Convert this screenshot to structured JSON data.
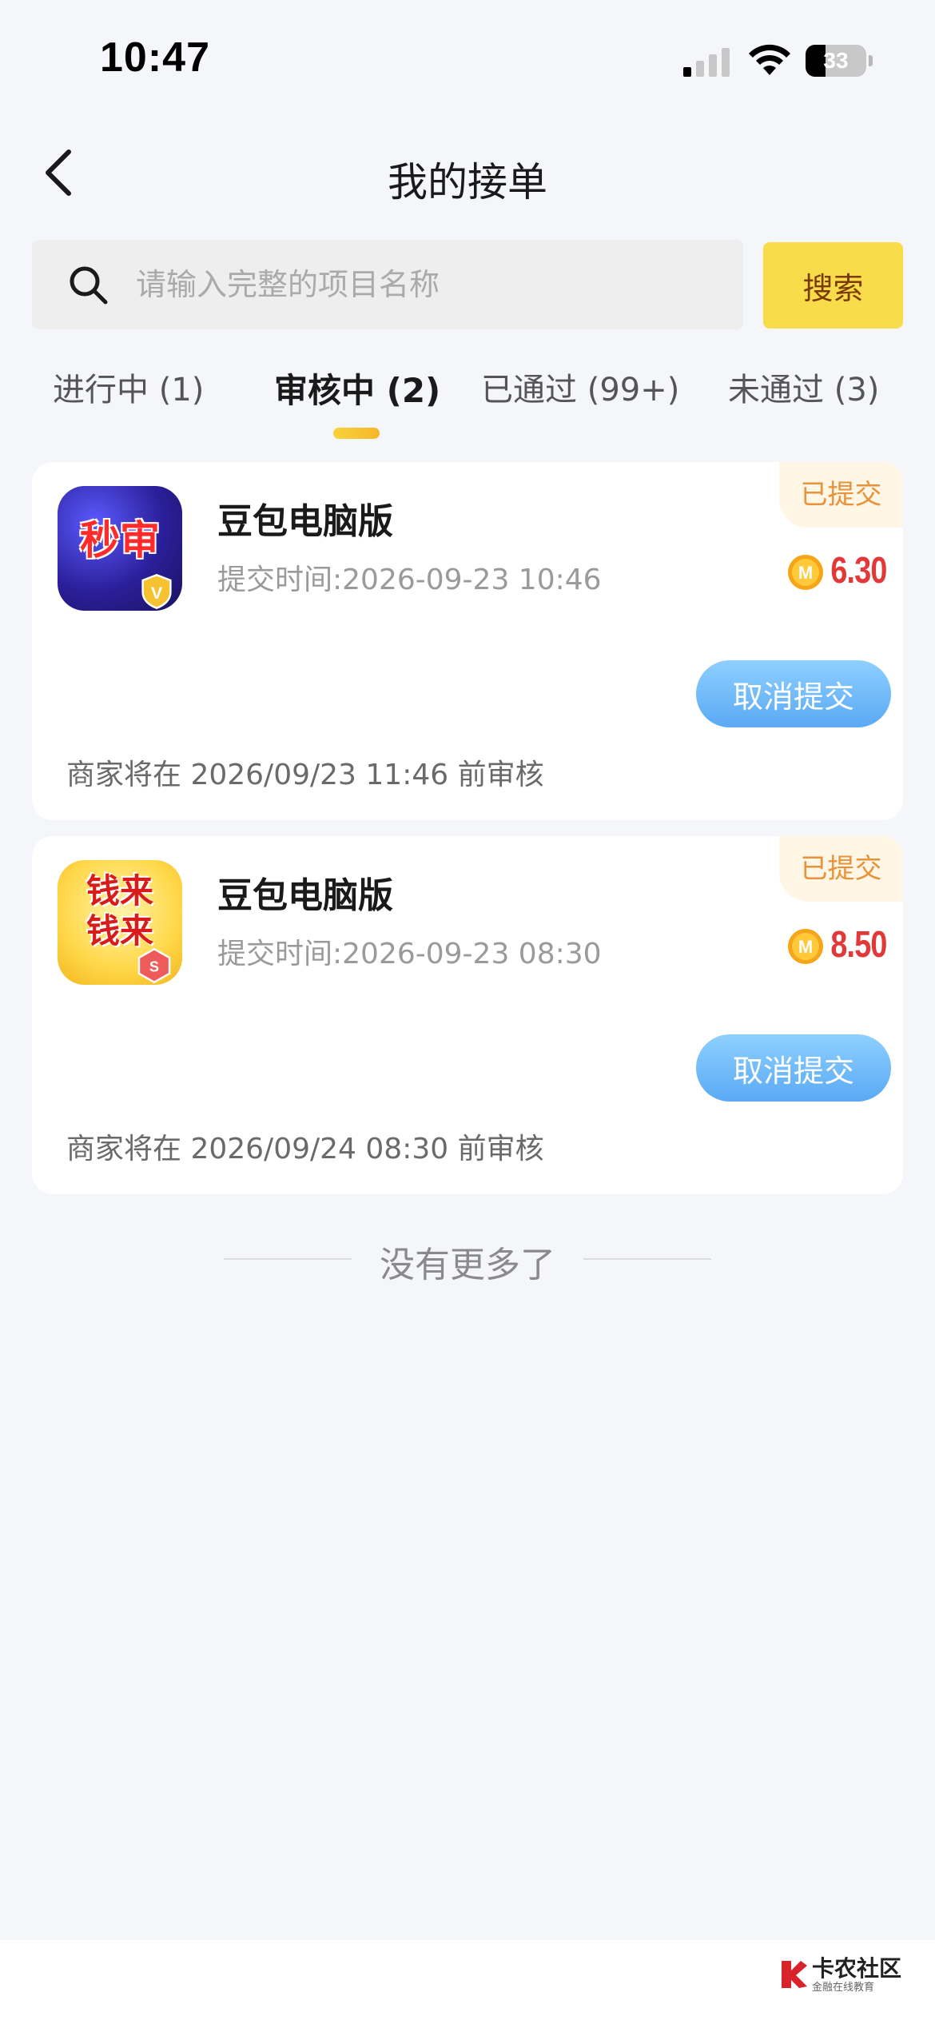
{
  "status_bar": {
    "time": "10:47",
    "battery_level": "33"
  },
  "header": {
    "title": "我的接单"
  },
  "search": {
    "placeholder": "请输入完整的项目名称",
    "value": "",
    "button_label": "搜索"
  },
  "tabs": [
    {
      "label": "进行中 (1)",
      "active": false
    },
    {
      "label": "审核中 (2)",
      "active": true
    },
    {
      "label": "已通过 (99+)",
      "active": false
    },
    {
      "label": "未通过 (3)",
      "active": false
    }
  ],
  "orders": [
    {
      "icon_text": "秒审",
      "icon_colors": [
        "#3b3bd6",
        "#d61b2a"
      ],
      "title": "豆包电脑版",
      "submit_time": "提交时间:2026-09-23 10:46",
      "status": "已提交",
      "reward": "6.30",
      "action_label": "取消提交",
      "review_note": "商家将在 2026/09/23 11:46 前审核"
    },
    {
      "icon_text": "钱来钱来",
      "icon_colors": [
        "#ffd84a",
        "#d81c1c"
      ],
      "title": "豆包电脑版",
      "submit_time": "提交时间:2026-09-23 08:30",
      "status": "已提交",
      "reward": "8.50",
      "action_label": "取消提交",
      "review_note": "商家将在 2026/09/24 08:30 前审核"
    }
  ],
  "list_end_text": "没有更多了",
  "watermark": {
    "title": "卡农社区",
    "subtitle": "金融在线教育"
  },
  "colors": {
    "accent_yellow": "#f8dc4a",
    "reward_red": "#e23838",
    "button_blue": "#5aa9f5",
    "status_orange": "#e8923a"
  }
}
